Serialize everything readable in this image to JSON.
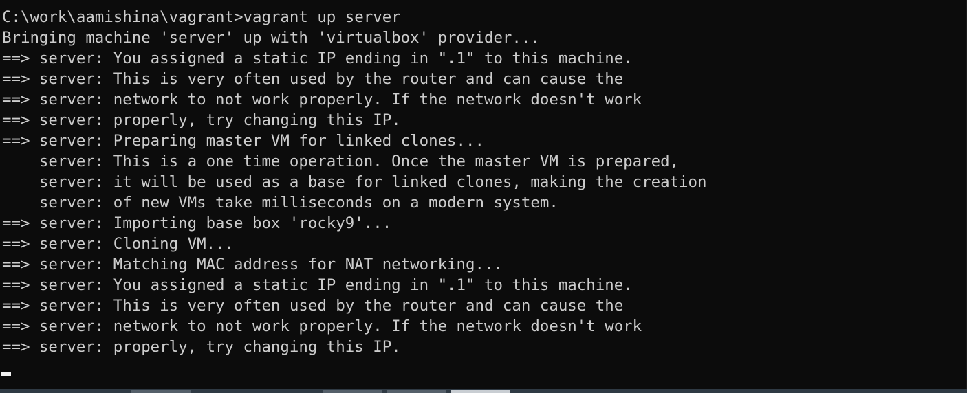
{
  "terminal": {
    "lines": [
      "C:\\work\\aamishina\\vagrant>vagrant up server",
      "Bringing machine 'server' up with 'virtualbox' provider...",
      "==> server: You assigned a static IP ending in \".1\" to this machine.",
      "==> server: This is very often used by the router and can cause the",
      "==> server: network to not work properly. If the network doesn't work",
      "==> server: properly, try changing this IP.",
      "==> server: Preparing master VM for linked clones...",
      "    server: This is a one time operation. Once the master VM is prepared,",
      "    server: it will be used as a base for linked clones, making the creation",
      "    server: of new VMs take milliseconds on a modern system.",
      "==> server: Importing base box 'rocky9'...",
      "==> server: Cloning VM...",
      "==> server: Matching MAC address for NAT networking...",
      "==> server: You assigned a static IP ending in \".1\" to this machine.",
      "==> server: This is very often used by the router and can cause the",
      "==> server: network to not work properly. If the network doesn't work",
      "==> server: properly, try changing this IP."
    ]
  },
  "colors": {
    "background": "#0c0c0c",
    "text": "#cccccc",
    "cursor": "#f2f2f2"
  }
}
